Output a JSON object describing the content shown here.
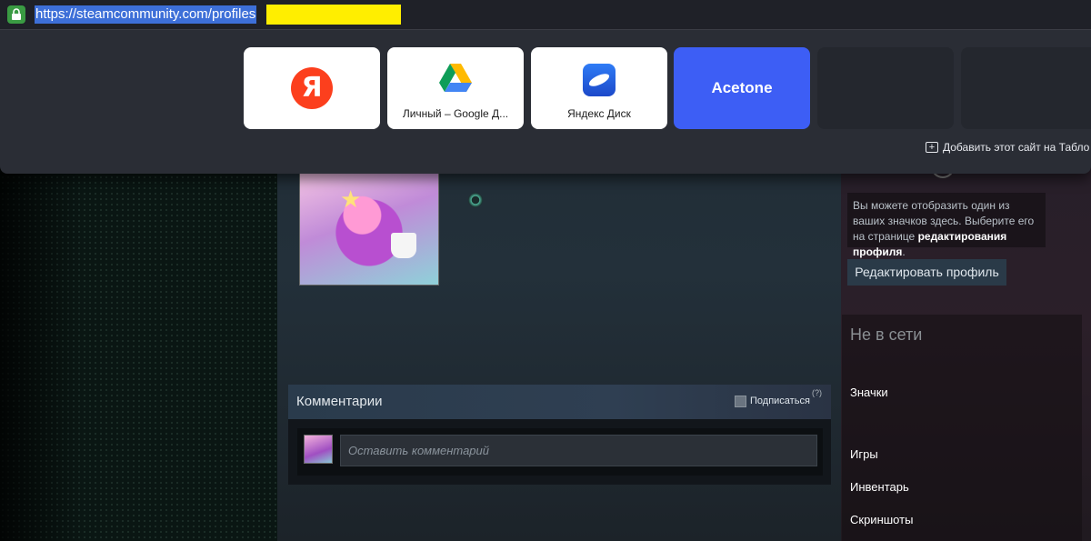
{
  "browser": {
    "url": "https://steamcommunity.com/profiles",
    "tableau": {
      "tiles": [
        {
          "name": "yandex",
          "label": "",
          "logo": "Я"
        },
        {
          "name": "google-drive",
          "label": "Личный – Google Д..."
        },
        {
          "name": "yandex-disk",
          "label": "Яндекс Диск"
        },
        {
          "name": "acetone",
          "label": "Acetone"
        }
      ],
      "add_site_label": "Добавить этот сайт на Табло"
    }
  },
  "profile": {
    "badge_info": {
      "text_before": "Вы можете отобразить один из ваших значков здесь. Выберите его на странице ",
      "link": "редактирования профиля",
      "text_after": "."
    },
    "edit_profile_label": "Редактировать профиль",
    "status": "Не в сети",
    "nav": {
      "badges": "Значки",
      "games": "Игры",
      "inventory": "Инвентарь",
      "screenshots": "Скриншоты"
    }
  },
  "comments": {
    "title": "Комментарии",
    "subscribe_label": "Подписаться",
    "help": "(?)",
    "input_placeholder": "Оставить комментарий"
  },
  "colors": {
    "accent_blue": "#3d5ef5",
    "url_highlight": "#3d6fd8",
    "redaction": "#ffee00",
    "lock_green": "#3a9b43"
  }
}
